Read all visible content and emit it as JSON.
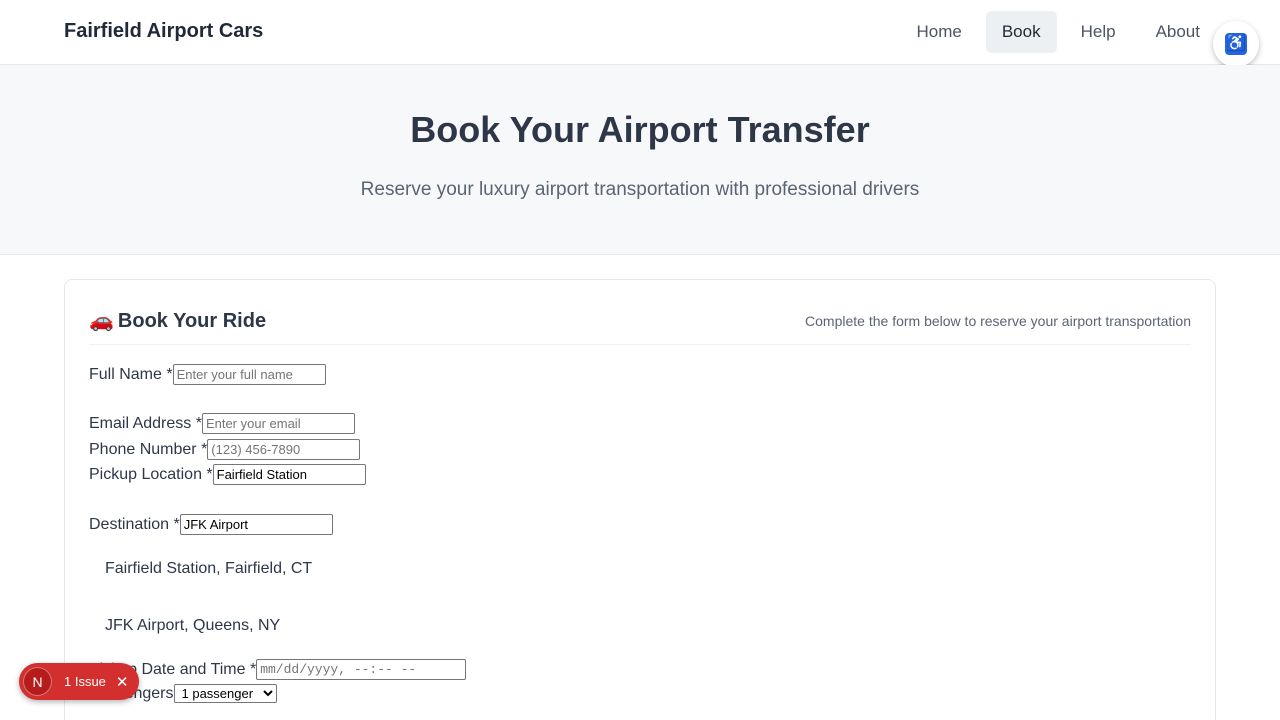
{
  "brand": "Fairfield Airport Cars",
  "nav": [
    {
      "label": "Home"
    },
    {
      "label": "Book"
    },
    {
      "label": "Help"
    },
    {
      "label": "About"
    }
  ],
  "accessibility_icon": "accessibility-icon",
  "hero": {
    "title": "Book Your Airport Transfer",
    "subtitle": "Reserve your luxury airport transportation with professional drivers"
  },
  "form": {
    "title_icon": "🚗",
    "title": "Book Your Ride",
    "subtitle": "Complete the form below to reserve your airport transportation",
    "full_name": {
      "label": "Full Name *",
      "placeholder": "Enter your full name",
      "value": ""
    },
    "email": {
      "label": "Email Address *",
      "placeholder": "Enter your email",
      "value": ""
    },
    "phone": {
      "label": "Phone Number *",
      "placeholder": "(123) 456-7890",
      "value": ""
    },
    "pickup": {
      "label": "Pickup Location *",
      "value": "Fairfield Station"
    },
    "destination": {
      "label": "Destination *",
      "value": "JFK Airport"
    },
    "pickup_suggestion": "Fairfield Station, Fairfield, CT",
    "destination_suggestion": "JFK Airport, Queens, NY",
    "datetime": {
      "label": "Pickup Date and Time *",
      "placeholder": "mm/dd/yyyy, --:-- --"
    },
    "passengers": {
      "label": "Passengers",
      "selected": "1 passenger"
    }
  },
  "issues": {
    "badge": "N",
    "label": "1 Issue"
  }
}
